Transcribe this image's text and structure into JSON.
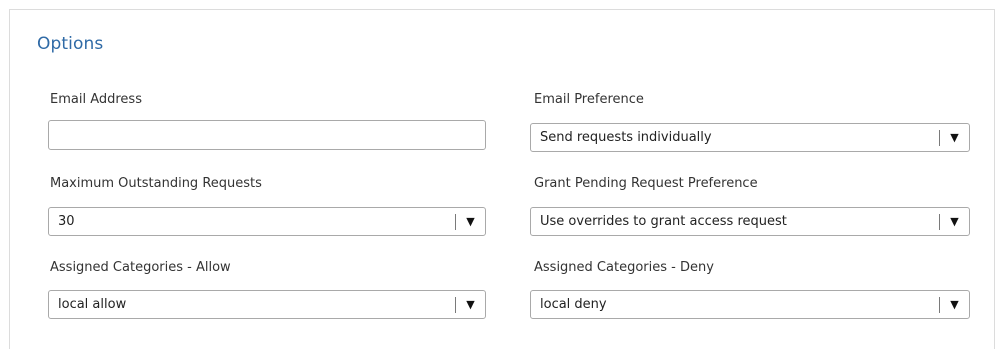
{
  "section": {
    "title": "Options"
  },
  "fields": {
    "email_address": {
      "label": "Email Address",
      "value": "",
      "placeholder": ""
    },
    "email_preference": {
      "label": "Email Preference",
      "selected": "Send requests individually"
    },
    "max_outstanding_requests": {
      "label": "Maximum Outstanding Requests",
      "selected": "30"
    },
    "grant_pending_request_preference": {
      "label": "Grant Pending Request Preference",
      "selected": "Use overrides to grant access request"
    },
    "assigned_categories_allow": {
      "label": "Assigned Categories - Allow",
      "selected": "local allow"
    },
    "assigned_categories_deny": {
      "label": "Assigned Categories - Deny",
      "selected": "local deny"
    }
  },
  "icons": {
    "dropdown_arrow": "▼"
  },
  "colors": {
    "title": "#2f6aa6",
    "label": "#333333",
    "border": "#a9a9a9",
    "panel_border": "#dcdcdc"
  }
}
